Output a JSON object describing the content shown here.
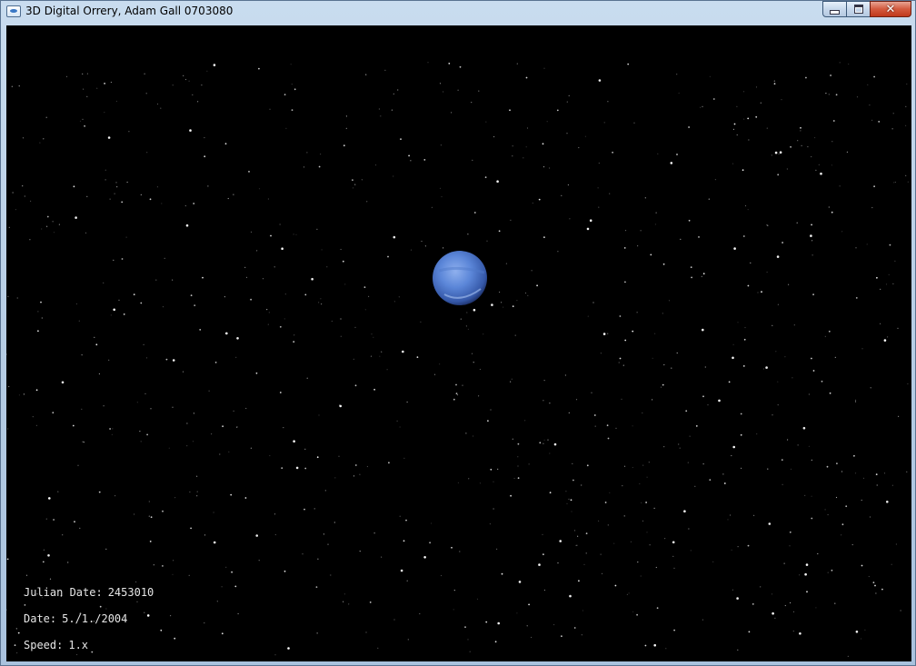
{
  "window": {
    "title": "3D Digital Orrery, Adam Gall 0703080",
    "controls": {
      "minimize_icon": "minimize-icon",
      "maximize_icon": "maximize-icon",
      "close_symbol": "✕"
    }
  },
  "scene": {
    "background_color": "#000000",
    "planet_color": "#5b86d8"
  },
  "hud": {
    "julian_date_label": "Julian Date:",
    "julian_date_value": "2453010",
    "date_label": "Date:",
    "date_value": "5./1./2004",
    "speed_label": "Speed:",
    "speed_value": "1.x"
  }
}
